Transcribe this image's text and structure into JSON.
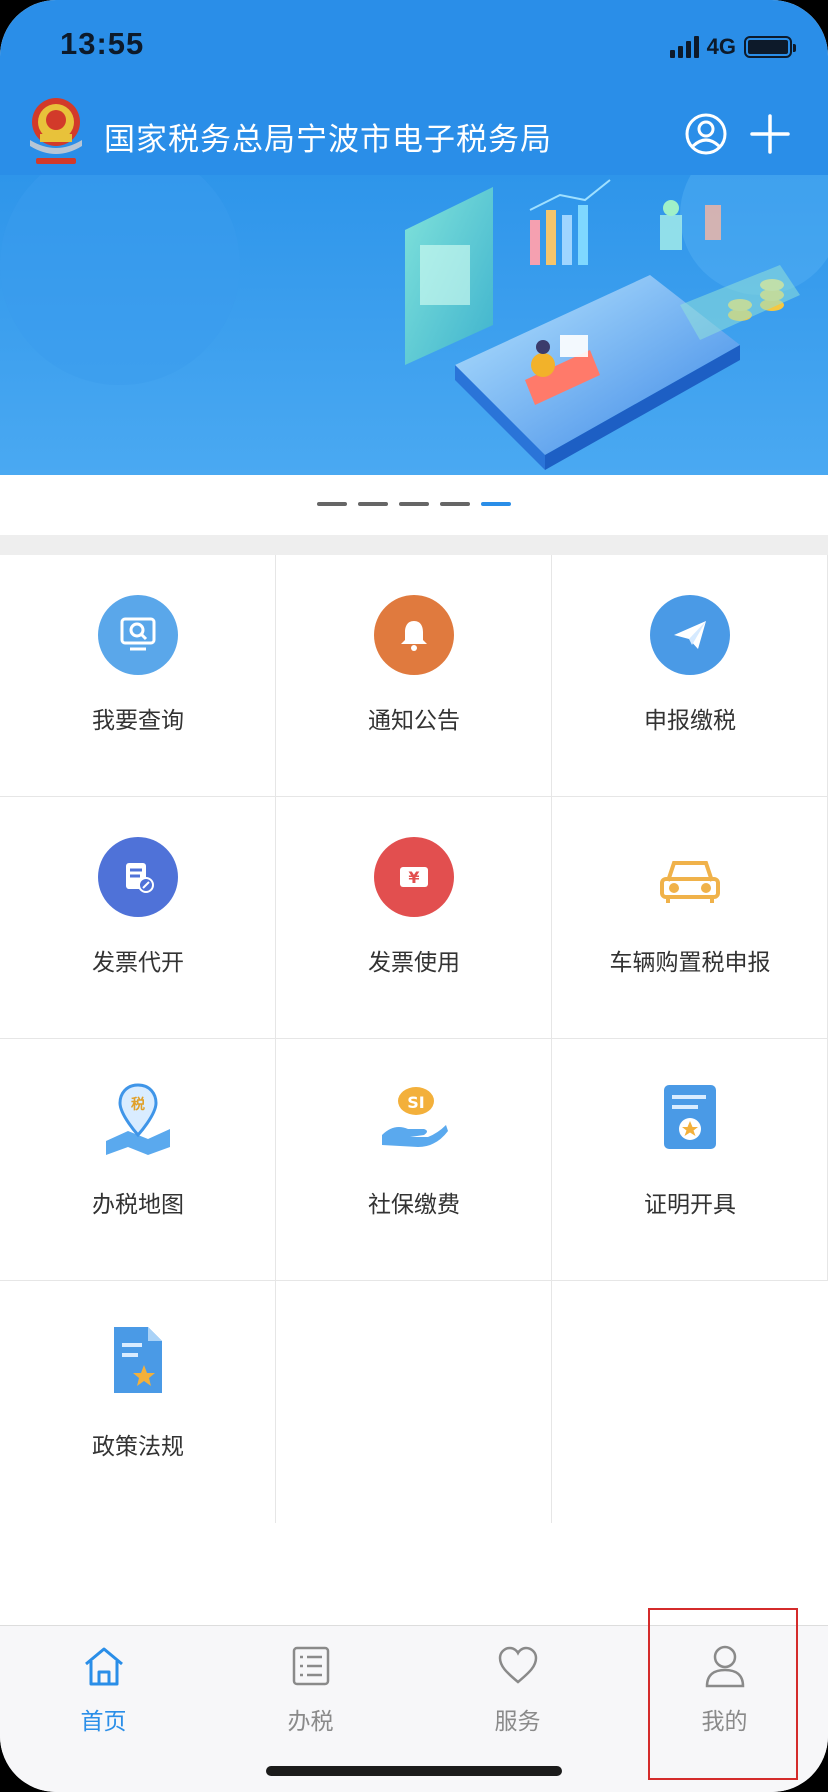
{
  "status_bar": {
    "time": "13:55",
    "network": "4G"
  },
  "header": {
    "title": "国家税务总局宁波市电子税务局"
  },
  "banner": {
    "dots_count": 5,
    "active_dot": 4
  },
  "grid": {
    "items": [
      {
        "label": "我要查询",
        "icon": "query-screen-icon",
        "color": "#5aa7ea"
      },
      {
        "label": "通知公告",
        "icon": "bell-icon",
        "color": "#e07a3e"
      },
      {
        "label": "申报缴税",
        "icon": "paper-plane-icon",
        "color": "#4a9ae6"
      },
      {
        "label": "发票代开",
        "icon": "invoice-edit-icon",
        "color": "#4f72d8"
      },
      {
        "label": "发票使用",
        "icon": "invoice-yen-icon",
        "color": "#e24f4f"
      },
      {
        "label": "车辆购置税申报",
        "icon": "car-icon",
        "color": "#f0b24a"
      },
      {
        "label": "办税地图",
        "icon": "map-pin-icon",
        "color": "#3f95e8"
      },
      {
        "label": "社保缴费",
        "icon": "social-security-icon",
        "color": "#f3b03b"
      },
      {
        "label": "证明开具",
        "icon": "certificate-icon",
        "color": "#4a9ae6"
      },
      {
        "label": "政策法规",
        "icon": "policy-doc-icon",
        "color": "#4a9ae6"
      }
    ]
  },
  "tabbar": {
    "tabs": [
      {
        "label": "首页",
        "icon": "home-icon",
        "active": true
      },
      {
        "label": "办税",
        "icon": "list-icon",
        "active": false
      },
      {
        "label": "服务",
        "icon": "heart-icon",
        "active": false
      },
      {
        "label": "我的",
        "icon": "person-icon",
        "active": false
      }
    ]
  },
  "colors": {
    "brand_blue": "#2a8ee8",
    "highlight_red": "#d42b2b"
  }
}
